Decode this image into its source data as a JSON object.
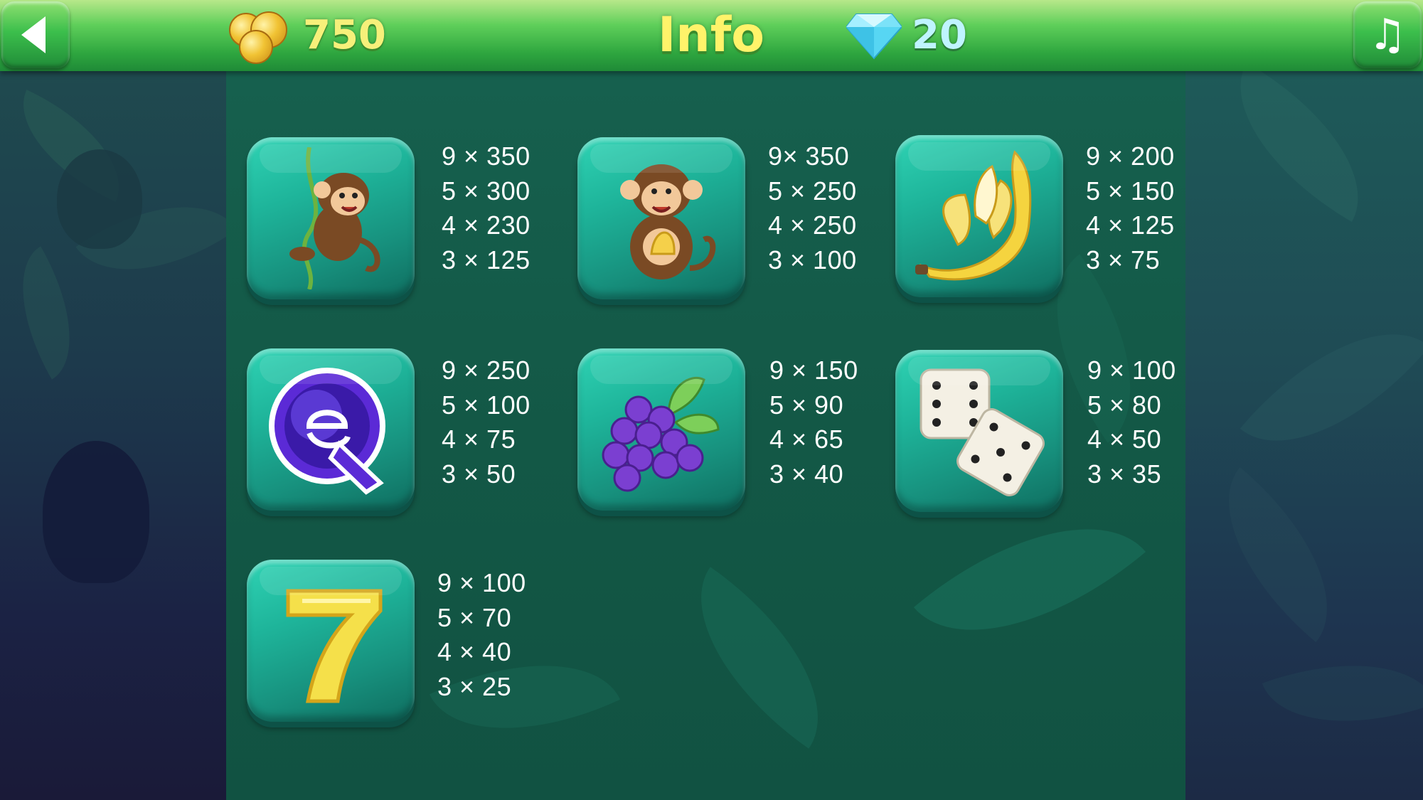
{
  "header": {
    "title": "Info",
    "coins": "750",
    "gems": "20",
    "back_icon": "back-arrow-icon",
    "music_icon": "music-note-icon",
    "coin_icon": "gold-coins-icon",
    "gem_icon": "diamond-icon"
  },
  "colors": {
    "header_green": "#2ea63f",
    "title_yellow": "#fff36a",
    "panel_green": "#135846",
    "tile_teal": "#1eb49a"
  },
  "paytable": [
    {
      "symbol": "monkey-on-vine-icon",
      "lines": [
        "9 × 350",
        "5 × 300",
        "4 × 230",
        "3 × 125"
      ]
    },
    {
      "symbol": "monkey-with-banana-icon",
      "lines": [
        "9× 350",
        "5 × 250",
        "4 × 250",
        "3 × 100"
      ]
    },
    {
      "symbol": "banana-icon",
      "lines": [
        "9 × 200",
        "5 × 150",
        "4 × 125",
        "3 × 75"
      ]
    },
    {
      "symbol": "letter-q-icon",
      "lines": [
        "9 × 250",
        "5 × 100",
        "4 × 75",
        "3 × 50"
      ]
    },
    {
      "symbol": "grapes-icon",
      "lines": [
        "9 × 150",
        "5 × 90",
        "4 × 65",
        "3 × 40"
      ]
    },
    {
      "symbol": "dice-icon",
      "lines": [
        "9 × 100",
        "5 × 80",
        "4 × 50",
        "3 × 35"
      ]
    },
    {
      "symbol": "seven-icon",
      "lines": [
        "9 × 100",
        "5 × 70",
        "4 × 40",
        "3 × 25"
      ]
    }
  ]
}
